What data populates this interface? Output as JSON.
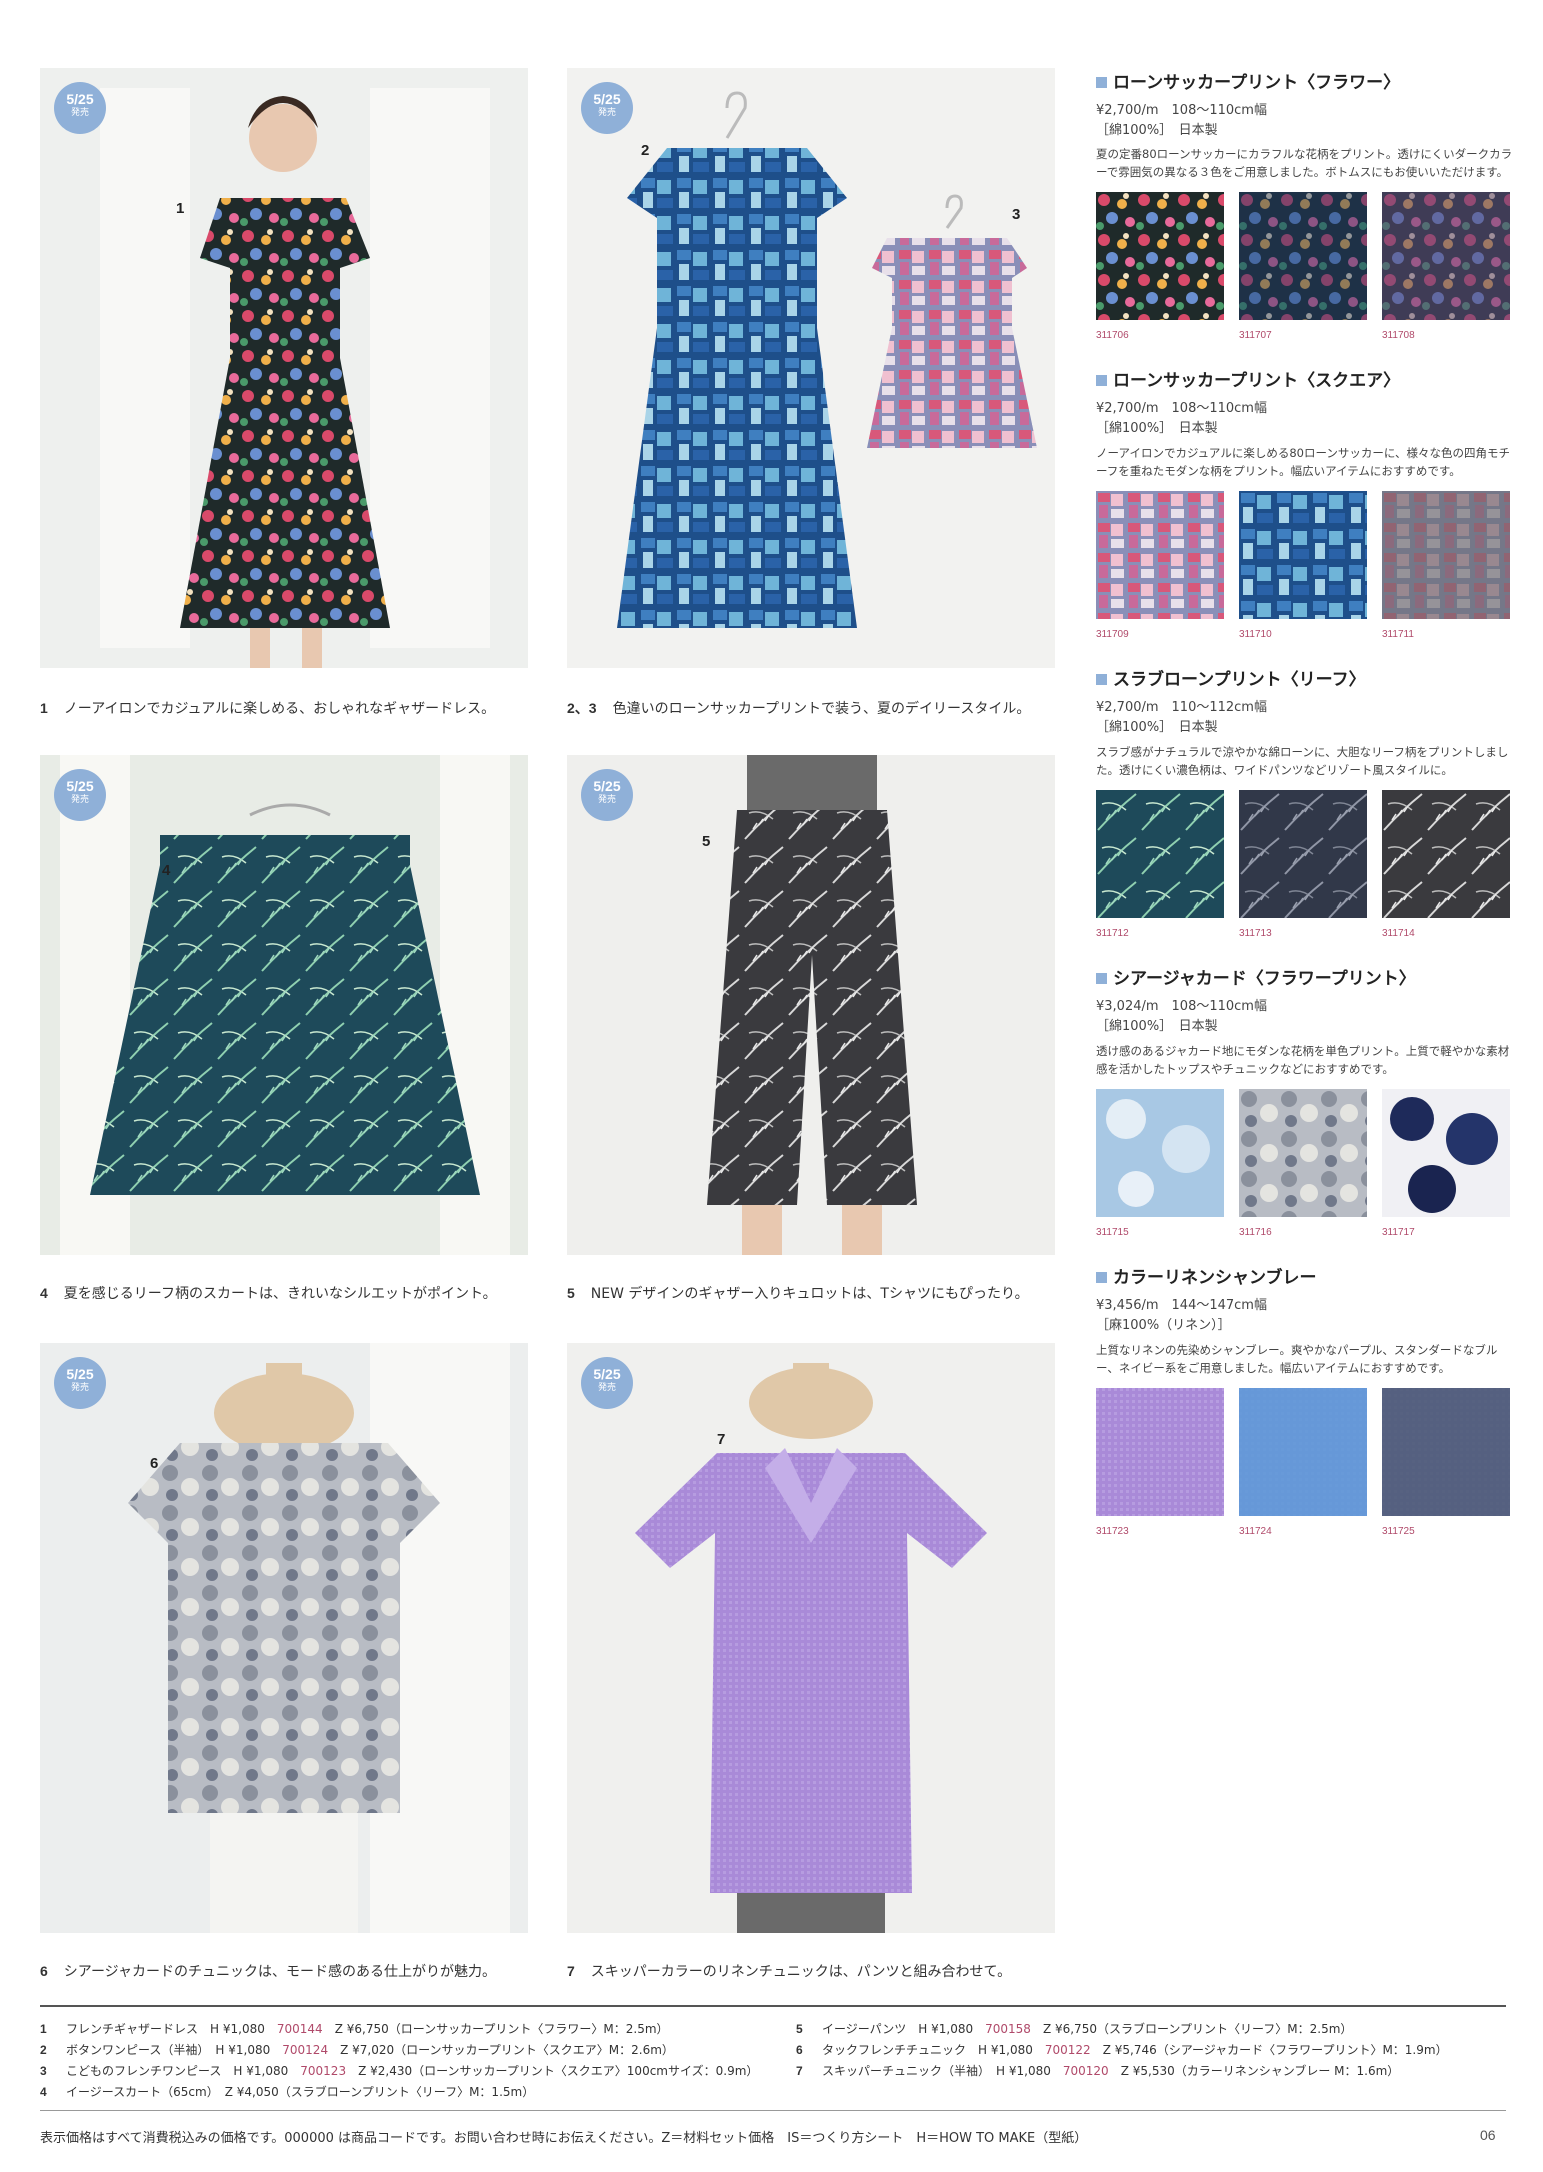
{
  "badge": {
    "date": "5/25",
    "sub": "発売"
  },
  "photos": {
    "p1": {
      "num": "1"
    },
    "p23": {
      "num2": "2",
      "num3": "3"
    },
    "p4": {
      "num": "4"
    },
    "p5": {
      "num": "5"
    },
    "p6": {
      "num": "6"
    },
    "p7": {
      "num": "7"
    }
  },
  "captions": [
    {
      "num": "1",
      "text": "ノーアイロンでカジュアルに楽しめる、おしゃれなギャザードレス。"
    },
    {
      "num": "2、3",
      "text": "色違いのローンサッカープリントで装う、夏のデイリースタイル。"
    },
    {
      "num": "4",
      "text": "夏を感じるリーフ柄のスカートは、きれいなシルエットがポイント。"
    },
    {
      "num": "5",
      "text": "NEW デザインのギャザー入りキュロットは、Tシャツにもぴったり。"
    },
    {
      "num": "6",
      "text": "シアージャカードのチュニックは、モード感のある仕上がりが魅力。"
    },
    {
      "num": "7",
      "text": "スキッパーカラーのリネンチュニックは、パンツと組み合わせて。"
    }
  ],
  "fabrics": [
    {
      "title": "ローンサッカープリント〈フラワー〉",
      "price": "¥2,700/m　108〜110cm幅",
      "content": "［綿100%］　日本製",
      "desc": "夏の定番80ローンサッカーにカラフルな花柄をプリント。透けにくいダークカラーで雰囲気の異なる３色をご用意しました。ボトムスにもお使いいただけます。",
      "codes": [
        "311706",
        "311707",
        "311708"
      ]
    },
    {
      "title": "ローンサッカープリント〈スクエア〉",
      "price": "¥2,700/m　108〜110cm幅",
      "content": "［綿100%］　日本製",
      "desc": "ノーアイロンでカジュアルに楽しめる80ローンサッカーに、様々な色の四角モチーフを重ねたモダンな柄をプリント。幅広いアイテムにおすすめです。",
      "codes": [
        "311709",
        "311710",
        "311711"
      ]
    },
    {
      "title": "スラブローンプリント〈リーフ〉",
      "price": "¥2,700/m　110〜112cm幅",
      "content": "［綿100%］　日本製",
      "desc": "スラブ感がナチュラルで涼やかな綿ローンに、大胆なリーフ柄をプリントしました。透けにくい濃色柄は、ワイドパンツなどリゾート風スタイルに。",
      "codes": [
        "311712",
        "311713",
        "311714"
      ]
    },
    {
      "title": "シアージャカード〈フラワープリント〉",
      "price": "¥3,024/m　108〜110cm幅",
      "content": "［綿100%］　日本製",
      "desc": "透け感のあるジャカード地にモダンな花柄を単色プリント。上質で軽やかな素材感を活かしたトップスやチュニックなどにおすすめです。",
      "codes": [
        "311715",
        "311716",
        "311717"
      ]
    },
    {
      "title": "カラーリネンシャンブレー",
      "price": "¥3,456/m　144〜147cm幅",
      "content": "［麻100%（リネン）］",
      "desc": "上質なリネンの先染めシャンブレー。爽やかなパープル、スタンダードなブルー、ネイビー系をご用意しました。幅広いアイテムにおすすめです。",
      "codes": [
        "311723",
        "311724",
        "311725"
      ]
    }
  ],
  "credits": [
    {
      "num": "1",
      "name": "フレンチギャザードレス",
      "h": "H ¥1,080",
      "code": "700144",
      "z": "Z ¥6,750（ローンサッカープリント〈フラワー〉M：2.5m）"
    },
    {
      "num": "2",
      "name": "ボタンワンピース（半袖）",
      "h": "H ¥1,080",
      "code": "700124",
      "z": "Z ¥7,020（ローンサッカープリント〈スクエア〉M：2.6m）"
    },
    {
      "num": "3",
      "name": "こどものフレンチワンピース",
      "h": "H ¥1,080",
      "code": "700123",
      "z": "Z ¥2,430（ローンサッカープリント〈スクエア〉100cmサイズ：0.9m）"
    },
    {
      "num": "4",
      "name": "イージースカート（65cm）",
      "h": "",
      "code": "",
      "z": "Z ¥4,050（スラブローンプリント〈リーフ〉M：1.5m）"
    },
    {
      "num": "5",
      "name": "イージーパンツ",
      "h": "H ¥1,080",
      "code": "700158",
      "z": "Z ¥6,750（スラブローンプリント〈リーフ〉M：2.5m）"
    },
    {
      "num": "6",
      "name": "タックフレンチチュニック",
      "h": "H ¥1,080",
      "code": "700122",
      "z": "Z ¥5,746（シアージャカード〈フラワープリント〉M：1.9m）"
    },
    {
      "num": "7",
      "name": "スキッパーチュニック（半袖）",
      "h": "H ¥1,080",
      "code": "700120",
      "z": "Z ¥5,530（カラーリネンシャンブレー M：1.6m）"
    }
  ],
  "footer": {
    "note": "表示価格はすべて消費税込みの価格です。000000 は商品コードです。お問い合わせ時にお伝えください。Z＝材料セット価格　IS＝つくり方シート　H＝HOW TO MAKE（型紙）",
    "page": "06"
  },
  "colors": {
    "accent": "#8fb0d8",
    "code": "#b04a6a",
    "rule": "#555555"
  }
}
